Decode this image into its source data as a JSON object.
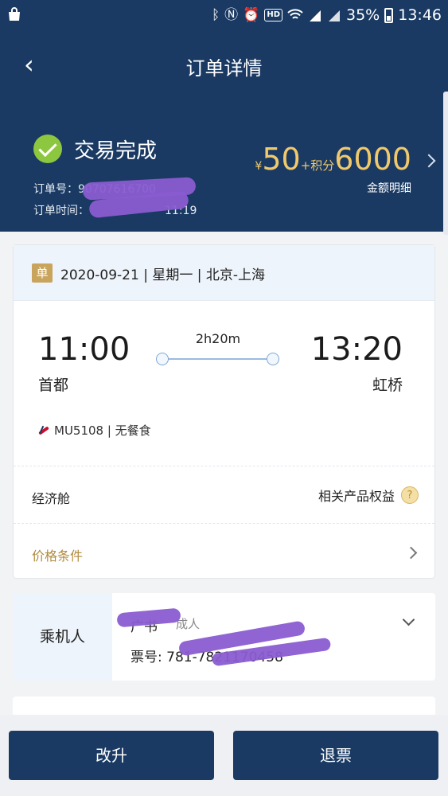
{
  "status_bar": {
    "battery": "35%",
    "time": "13:46",
    "icons": [
      "shopping-bag-icon",
      "bluetooth-icon",
      "nfc-icon",
      "alarm-icon",
      "hd-icon",
      "wifi-icon",
      "signal-4g-icon",
      "signal-3g-icon",
      "battery-icon"
    ]
  },
  "header": {
    "title": "订单详情",
    "status": "交易完成",
    "order_no_label": "订单号：9",
    "order_no_visible": "0707616700",
    "order_time_label": "订单时间：",
    "order_time_visible": "11:19",
    "price": {
      "currency": "¥",
      "amount": "50",
      "plus_points_label": "+积分",
      "points": "6000",
      "detail_label": "金额明细"
    }
  },
  "flight": {
    "badge": "单",
    "date": "2020-09-21",
    "weekday": "星期一",
    "route": "北京-上海",
    "date_line": "2020-09-21 | 星期一 | 北京-上海",
    "dep_time": "11:00",
    "dep_city": "首都",
    "arr_time": "13:20",
    "arr_city": "虹桥",
    "duration": "2h20m",
    "flight_info": "MU5108 | 无餐食",
    "cabin": "经济舱",
    "benefits": "相关产品权益",
    "help": "?",
    "price_conditions": "价格条件"
  },
  "passenger": {
    "label": "乘机人",
    "name": "广书",
    "type": "成人",
    "ticket_label": "票号:",
    "ticket_visible": "781-7821170458"
  },
  "actions": {
    "upgrade": "改升",
    "refund": "退票"
  },
  "colors": {
    "header_bg": "#1a3a63",
    "accent_gold": "#f1c96b",
    "success_green": "#8dc63f",
    "condition_gold": "#b08a3e",
    "redaction": "#8a5cd0"
  }
}
